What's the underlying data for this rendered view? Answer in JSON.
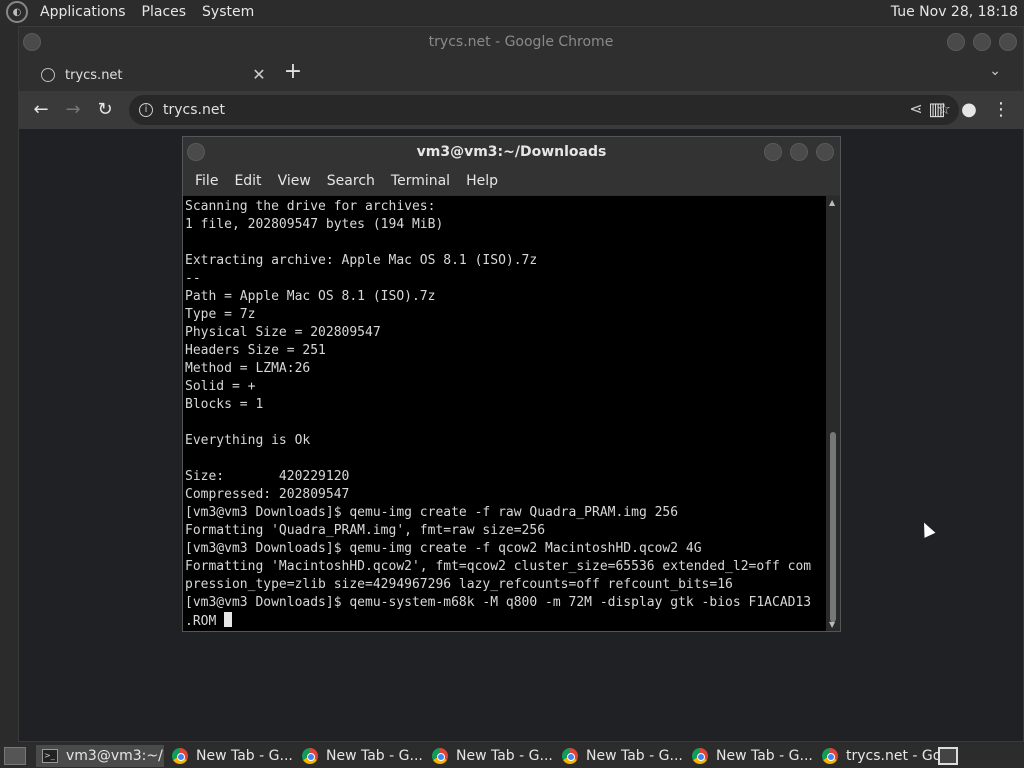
{
  "top_panel": {
    "menus": [
      "Applications",
      "Places",
      "System"
    ],
    "clock": "Tue Nov 28, 18:18"
  },
  "chrome": {
    "window_title": "trycs.net - Google Chrome",
    "tab_title": "trycs.net",
    "address": "trycs.net"
  },
  "terminal": {
    "title": "vm3@vm3:~/Downloads",
    "menus": [
      "File",
      "Edit",
      "View",
      "Search",
      "Terminal",
      "Help"
    ],
    "lines": [
      "Scanning the drive for archives:",
      "1 file, 202809547 bytes (194 MiB)",
      "",
      "Extracting archive: Apple Mac OS 8.1 (ISO).7z",
      "--",
      "Path = Apple Mac OS 8.1 (ISO).7z",
      "Type = 7z",
      "Physical Size = 202809547",
      "Headers Size = 251",
      "Method = LZMA:26",
      "Solid = +",
      "Blocks = 1",
      "",
      "Everything is Ok",
      "",
      "Size:       420229120",
      "Compressed: 202809547",
      "[vm3@vm3 Downloads]$ qemu-img create -f raw Quadra_PRAM.img 256",
      "Formatting 'Quadra_PRAM.img', fmt=raw size=256",
      "[vm3@vm3 Downloads]$ qemu-img create -f qcow2 MacintoshHD.qcow2 4G",
      "Formatting 'MacintoshHD.qcow2', fmt=qcow2 cluster_size=65536 extended_l2=off com",
      "pression_type=zlib size=4294967296 lazy_refcounts=off refcount_bits=16",
      "[vm3@vm3 Downloads]$ qemu-system-m68k -M q800 -m 72M -display gtk -bios F1ACAD13",
      ".ROM "
    ]
  },
  "taskbar": {
    "items": [
      {
        "label": "vm3@vm3:~/...",
        "icon": "terminal-icon",
        "active": true
      },
      {
        "label": "New Tab - G...",
        "icon": "chrome-icon",
        "active": false
      },
      {
        "label": "New Tab - G...",
        "icon": "chrome-icon",
        "active": false
      },
      {
        "label": "New Tab - G...",
        "icon": "chrome-icon",
        "active": false
      },
      {
        "label": "New Tab - G...",
        "icon": "chrome-icon",
        "active": false
      },
      {
        "label": "New Tab - G...",
        "icon": "chrome-icon",
        "active": false
      },
      {
        "label": "trycs.net - Go...",
        "icon": "chrome-icon",
        "active": false
      }
    ]
  }
}
